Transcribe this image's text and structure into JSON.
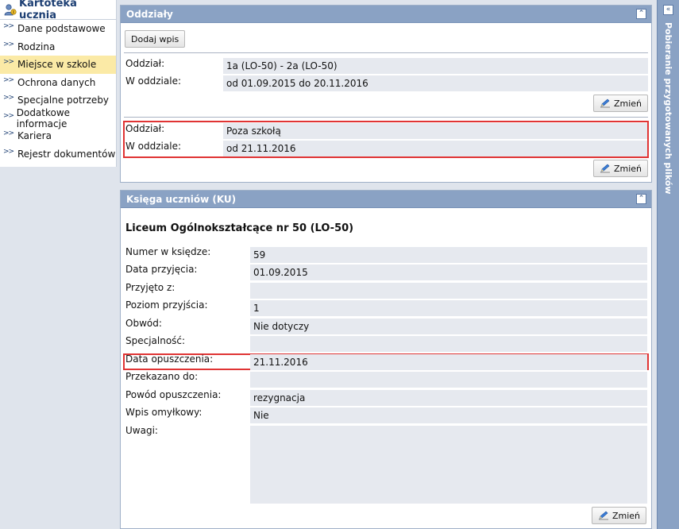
{
  "sidebar": {
    "title": "Kartoteka ucznia",
    "items": [
      {
        "label": "Dane podstawowe"
      },
      {
        "label": "Rodzina"
      },
      {
        "label": "Miejsce w szkole"
      },
      {
        "label": "Ochrona danych"
      },
      {
        "label": "Specjalne potrzeby"
      },
      {
        "label": "Dodatkowe informacje"
      },
      {
        "label": "Kariera"
      },
      {
        "label": "Rejestr dokumentów"
      }
    ],
    "active_index": 2
  },
  "oddzialy": {
    "title": "Oddziały",
    "add_button": "Dodaj wpis",
    "entries": [
      {
        "oddzial_label": "Oddział:",
        "oddzial_value": "1a (LO-50) - 2a (LO-50)",
        "w_oddziale_label": "W oddziale:",
        "w_oddziale_value": "od 01.09.2015 do 20.11.2016",
        "change_button": "Zmień"
      },
      {
        "oddzial_label": "Oddział:",
        "oddzial_value": "Poza szkołą",
        "w_oddziale_label": "W oddziale:",
        "w_oddziale_value": "od 21.11.2016",
        "change_button": "Zmień"
      }
    ]
  },
  "ksiega": {
    "title": "Księga uczniów (KU)",
    "school": "Liceum Ogólnokształcące nr 50 (LO-50)",
    "fields": [
      {
        "label": "Numer w księdze:",
        "value": "59"
      },
      {
        "label": "Data przyjęcia:",
        "value": "01.09.2015"
      },
      {
        "label": "Przyjęto z:",
        "value": ""
      },
      {
        "label": "Poziom przyjścia:",
        "value": "1"
      },
      {
        "label": "Obwód:",
        "value": "Nie dotyczy"
      },
      {
        "label": "Specjalność:",
        "value": ""
      },
      {
        "label": "Data opuszczenia:",
        "value": "21.11.2016"
      },
      {
        "label": "Przekazano do:",
        "value": ""
      },
      {
        "label": "Powód opuszczenia:",
        "value": "rezygnacja"
      },
      {
        "label": "Wpis omyłkowy:",
        "value": "Nie"
      },
      {
        "label": "Uwagi:",
        "value": ""
      }
    ],
    "change_button": "Zmień"
  },
  "right_panel": {
    "title": "Pobieranie przygotowanych plików"
  },
  "colors": {
    "header": "#8aa2c4",
    "active_item": "#fbeaa6",
    "highlight": "#e03434"
  }
}
